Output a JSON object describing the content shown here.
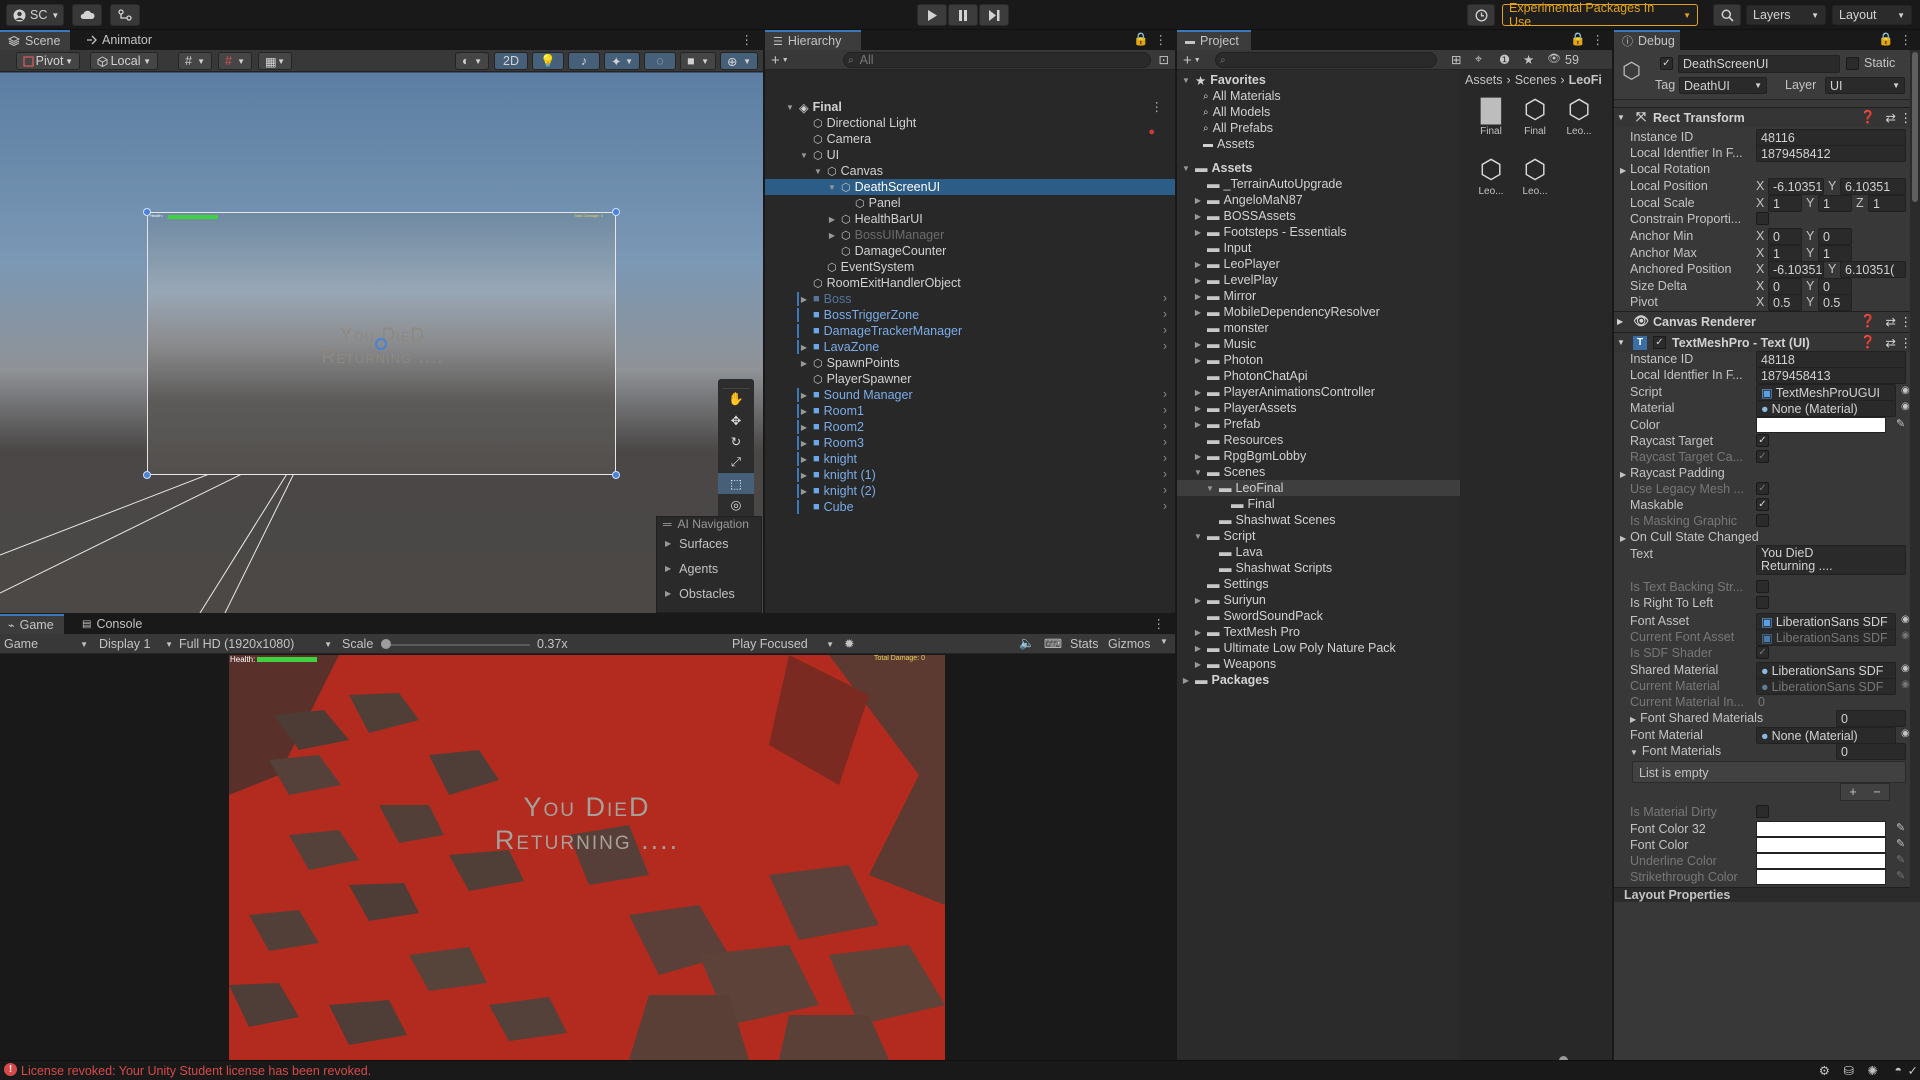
{
  "topbar": {
    "account": "SC",
    "packages_label": "Experimental Packages In Use",
    "layers_label": "Layers",
    "layout_label": "Layout"
  },
  "scene": {
    "tabs": [
      {
        "label": "Scene"
      },
      {
        "label": "Animator"
      }
    ],
    "toolbar": {
      "pivot": "Pivot",
      "local": "Local",
      "mode_2d": "2D"
    },
    "canvas_text": {
      "line1": "You DieD",
      "line2": "Returning ...."
    },
    "health_label": "Health:",
    "damage_label": "Total Damage: 0",
    "ai_nav": {
      "title": "AI Navigation",
      "items": [
        "Surfaces",
        "Agents",
        "Obstacles"
      ]
    }
  },
  "game": {
    "tabs": [
      {
        "label": "Game"
      },
      {
        "label": "Console"
      }
    ],
    "display_select": "Game",
    "display": "Display 1",
    "resolution": "Full HD (1920x1080)",
    "scale_label": "Scale",
    "scale_value": "0.37x",
    "scale_fraction": 0.03,
    "play_mode": "Play Focused",
    "stats": "Stats",
    "gizmos": "Gizmos",
    "health_label": "Health:",
    "damage_label": "Total Damage: 0",
    "text_line1": "You DieD",
    "text_line2": "Returning ...."
  },
  "hierarchy": {
    "tab": "Hierarchy",
    "search_placeholder": "All",
    "root": "Final",
    "items": [
      {
        "label": "Directional Light",
        "depth": 1,
        "kind": "go"
      },
      {
        "label": "Camera",
        "depth": 1,
        "kind": "go"
      },
      {
        "label": "UI",
        "depth": 1,
        "kind": "go",
        "expanded": true
      },
      {
        "label": "Canvas",
        "depth": 2,
        "kind": "go",
        "expanded": true
      },
      {
        "label": "DeathScreenUI",
        "depth": 3,
        "kind": "go",
        "expanded": true,
        "selected": true
      },
      {
        "label": "Panel",
        "depth": 4,
        "kind": "go"
      },
      {
        "label": "HealthBarUI",
        "depth": 3,
        "kind": "go",
        "collapsed": true
      },
      {
        "label": "BossUIManager",
        "depth": 3,
        "kind": "go",
        "collapsed": true,
        "dim": true
      },
      {
        "label": "DamageCounter",
        "depth": 3,
        "kind": "go"
      },
      {
        "label": "EventSystem",
        "depth": 2,
        "kind": "go"
      },
      {
        "label": "RoomExitHandlerObject",
        "depth": 1,
        "kind": "go"
      },
      {
        "label": "Boss",
        "depth": 1,
        "kind": "prefab",
        "collapsed": true,
        "dim": true
      },
      {
        "label": "BossTriggerZone",
        "depth": 1,
        "kind": "prefab"
      },
      {
        "label": "DamageTrackerManager",
        "depth": 1,
        "kind": "prefab"
      },
      {
        "label": "LavaZone",
        "depth": 1,
        "kind": "prefab",
        "collapsed": true
      },
      {
        "label": "SpawnPoints",
        "depth": 1,
        "kind": "go",
        "collapsed": true
      },
      {
        "label": "PlayerSpawner",
        "depth": 1,
        "kind": "go"
      },
      {
        "label": "Sound Manager",
        "depth": 1,
        "kind": "prefab",
        "collapsed": true
      },
      {
        "label": "Room1",
        "depth": 1,
        "kind": "prefab",
        "collapsed": true
      },
      {
        "label": "Room2",
        "depth": 1,
        "kind": "prefab",
        "collapsed": true
      },
      {
        "label": "Room3",
        "depth": 1,
        "kind": "prefab",
        "collapsed": true
      },
      {
        "label": "knight",
        "depth": 1,
        "kind": "prefab",
        "collapsed": true
      },
      {
        "label": "knight (1)",
        "depth": 1,
        "kind": "prefab",
        "collapsed": true
      },
      {
        "label": "knight (2)",
        "depth": 1,
        "kind": "prefab",
        "collapsed": true
      },
      {
        "label": "Cube",
        "depth": 1,
        "kind": "prefab"
      }
    ]
  },
  "project": {
    "tab": "Project",
    "hidden_count": "59",
    "breadcrumb": [
      "Assets",
      "Scenes",
      "LeoFi"
    ],
    "favorites_label": "Favorites",
    "favorites": [
      "All Materials",
      "All Models",
      "All Prefabs",
      "Assets"
    ],
    "assets_label": "Assets",
    "folders": [
      {
        "label": "_TerrainAutoUpgrade",
        "depth": 1
      },
      {
        "label": "AngeloMaN87",
        "depth": 1,
        "collapsed": true
      },
      {
        "label": "BOSSAssets",
        "depth": 1,
        "collapsed": true
      },
      {
        "label": "Footsteps - Essentials",
        "depth": 1,
        "collapsed": true
      },
      {
        "label": "Input",
        "depth": 1
      },
      {
        "label": "LeoPlayer",
        "depth": 1,
        "collapsed": true
      },
      {
        "label": "LevelPlay",
        "depth": 1,
        "collapsed": true
      },
      {
        "label": "Mirror",
        "depth": 1,
        "collapsed": true
      },
      {
        "label": "MobileDependencyResolver",
        "depth": 1,
        "collapsed": true
      },
      {
        "label": "monster",
        "depth": 1
      },
      {
        "label": "Music",
        "depth": 1,
        "collapsed": true
      },
      {
        "label": "Photon",
        "depth": 1,
        "collapsed": true
      },
      {
        "label": "PhotonChatApi",
        "depth": 1
      },
      {
        "label": "PlayerAnimationsController",
        "depth": 1,
        "collapsed": true
      },
      {
        "label": "PlayerAssets",
        "depth": 1,
        "collapsed": true
      },
      {
        "label": "Prefab",
        "depth": 1,
        "collapsed": true
      },
      {
        "label": "Resources",
        "depth": 1
      },
      {
        "label": "RpgBgmLobby",
        "depth": 1,
        "collapsed": true
      },
      {
        "label": "Scenes",
        "depth": 1,
        "expanded": true
      },
      {
        "label": "LeoFinal",
        "depth": 2,
        "expanded": true,
        "selected": true
      },
      {
        "label": "Final",
        "depth": 3
      },
      {
        "label": "Shashwat Scenes",
        "depth": 2
      },
      {
        "label": "Script",
        "depth": 1,
        "expanded": true
      },
      {
        "label": "Lava",
        "depth": 2
      },
      {
        "label": "Shashwat Scripts",
        "depth": 2
      },
      {
        "label": "Settings",
        "depth": 1
      },
      {
        "label": "Suriyun",
        "depth": 1,
        "collapsed": true
      },
      {
        "label": "SwordSoundPack",
        "depth": 1
      },
      {
        "label": "TextMesh Pro",
        "depth": 1,
        "collapsed": true
      },
      {
        "label": "Ultimate Low Poly Nature Pack",
        "depth": 1,
        "collapsed": true
      },
      {
        "label": "Weapons",
        "depth": 1,
        "collapsed": true
      }
    ],
    "packages_label": "Packages",
    "grid_items": [
      {
        "label": "Final",
        "type": "folder"
      },
      {
        "label": "Final",
        "type": "unity"
      },
      {
        "label": "Leo...",
        "type": "unity"
      },
      {
        "label": "Leo...",
        "type": "unity"
      },
      {
        "label": "Leo...",
        "type": "unity"
      }
    ]
  },
  "inspector": {
    "tab": "Debug",
    "object_name": "DeathScreenUI",
    "static_label": "Static",
    "tag_label": "Tag",
    "tag_value": "DeathUI",
    "layer_label": "Layer",
    "layer_value": "UI",
    "rect_transform": {
      "title": "Rect Transform",
      "instance_id_label": "Instance ID",
      "instance_id": "48116",
      "local_id_label": "Local Identfier In F...",
      "local_id": "1879458412",
      "local_rotation": "Local Rotation",
      "local_position_label": "Local Position",
      "local_position_x": "-6.103516e",
      "local_position_y": "6.10351",
      "local_scale_label": "Local Scale",
      "local_scale_x": "1",
      "local_scale_y": "1",
      "local_scale_z": "1",
      "constrain_label": "Constrain Proporti...",
      "anchor_min_label": "Anchor Min",
      "anchor_min_x": "0",
      "anchor_min_y": "0",
      "anchor_max_label": "Anchor Max",
      "anchor_max_x": "1",
      "anchor_max_y": "1",
      "anchored_position_label": "Anchored Position",
      "anchored_position_x": "-6.10351",
      "anchored_position_y": "6.10351(",
      "size_delta_label": "Size Delta",
      "size_delta_x": "0",
      "size_delta_y": "0",
      "pivot_label": "Pivot",
      "pivot_x": "0.5",
      "pivot_y": "0.5"
    },
    "canvas_renderer": {
      "title": "Canvas Renderer"
    },
    "tmp": {
      "title": "TextMeshPro - Text (UI)",
      "instance_id_label": "Instance ID",
      "instance_id": "48118",
      "local_id_label": "Local Identfier In F...",
      "local_id": "1879458413",
      "script_label": "Script",
      "script": "TextMeshProUGUI",
      "material_label": "Material",
      "material": "None (Material)",
      "color_label": "Color",
      "raycast_target_label": "Raycast Target",
      "raycast_target_ca_label": "Raycast Target Ca...",
      "raycast_padding_label": "Raycast Padding",
      "use_legacy_label": "Use Legacy Mesh ...",
      "maskable_label": "Maskable",
      "is_masking_label": "Is Masking Graphic",
      "on_cull_label": "On Cull State Changed",
      "text_label": "Text",
      "text_line1": "You DieD",
      "text_line2": "Returning ....",
      "is_text_backing_label": "Is Text Backing Str...",
      "is_rtl_label": "Is Right To Left",
      "font_asset_label": "Font Asset",
      "font_asset": "LiberationSans SDF",
      "current_font_label": "Current Font Asset",
      "current_font": "LiberationSans SDF",
      "is_sdf_label": "Is SDF Shader",
      "shared_material_label": "Shared Material",
      "shared_material": "LiberationSans SDF",
      "current_material_label": "Current Material",
      "current_material": "LiberationSans SDF",
      "current_material_in_label": "Current Material In...",
      "current_material_in": "0",
      "font_shared_materials_label": "Font Shared Materials",
      "font_shared_materials": "0",
      "font_material_label": "Font Material",
      "font_material": "None (Material)",
      "font_materials_label": "Font Materials",
      "font_materials": "0",
      "list_empty": "List is empty",
      "is_material_dirty_label": "Is Material Dirty",
      "font_color32_label": "Font Color 32",
      "font_color_label": "Font Color",
      "underline_color_label": "Underline Color",
      "strikethrough_color_label": "Strikethrough Color"
    },
    "layout_properties": "Layout Properties"
  },
  "statusbar": {
    "message": "License revoked: Your Unity Student license has been revoked."
  },
  "colors": {
    "accent": "#3a79bb",
    "prefab": "#7bace8",
    "selection": "#2c5d87",
    "error": "#d84a4a",
    "packages_border": "#e2a21a",
    "lava": "#b9271c"
  }
}
